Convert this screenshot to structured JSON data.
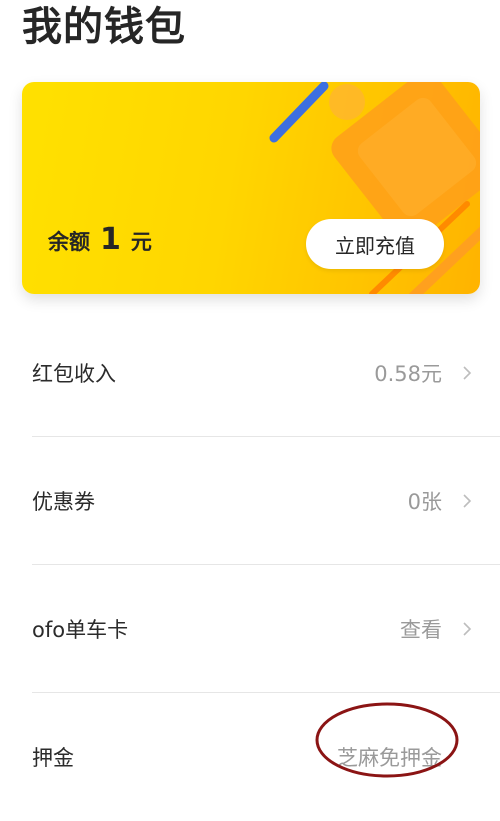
{
  "page": {
    "title": "我的钱包"
  },
  "card": {
    "balance_label": "余额",
    "balance_amount": "1",
    "balance_unit": "元",
    "recharge_label": "立即充值"
  },
  "rows": [
    {
      "label": "红包收入",
      "value": "0.58元",
      "icon": "chevron-right-icon"
    },
    {
      "label": "优惠券",
      "value": "0张",
      "icon": "chevron-right-icon"
    },
    {
      "label": "ofo单车卡",
      "value": "查看",
      "icon": "chevron-right-icon"
    },
    {
      "label": "押金",
      "value": "芝麻免押金"
    }
  ],
  "colors": {
    "card_yellow": "#ffd600",
    "card_orange": "#ff9f1a",
    "accent_blue": "#3d6fe0",
    "annotation_red": "#8b1414"
  }
}
